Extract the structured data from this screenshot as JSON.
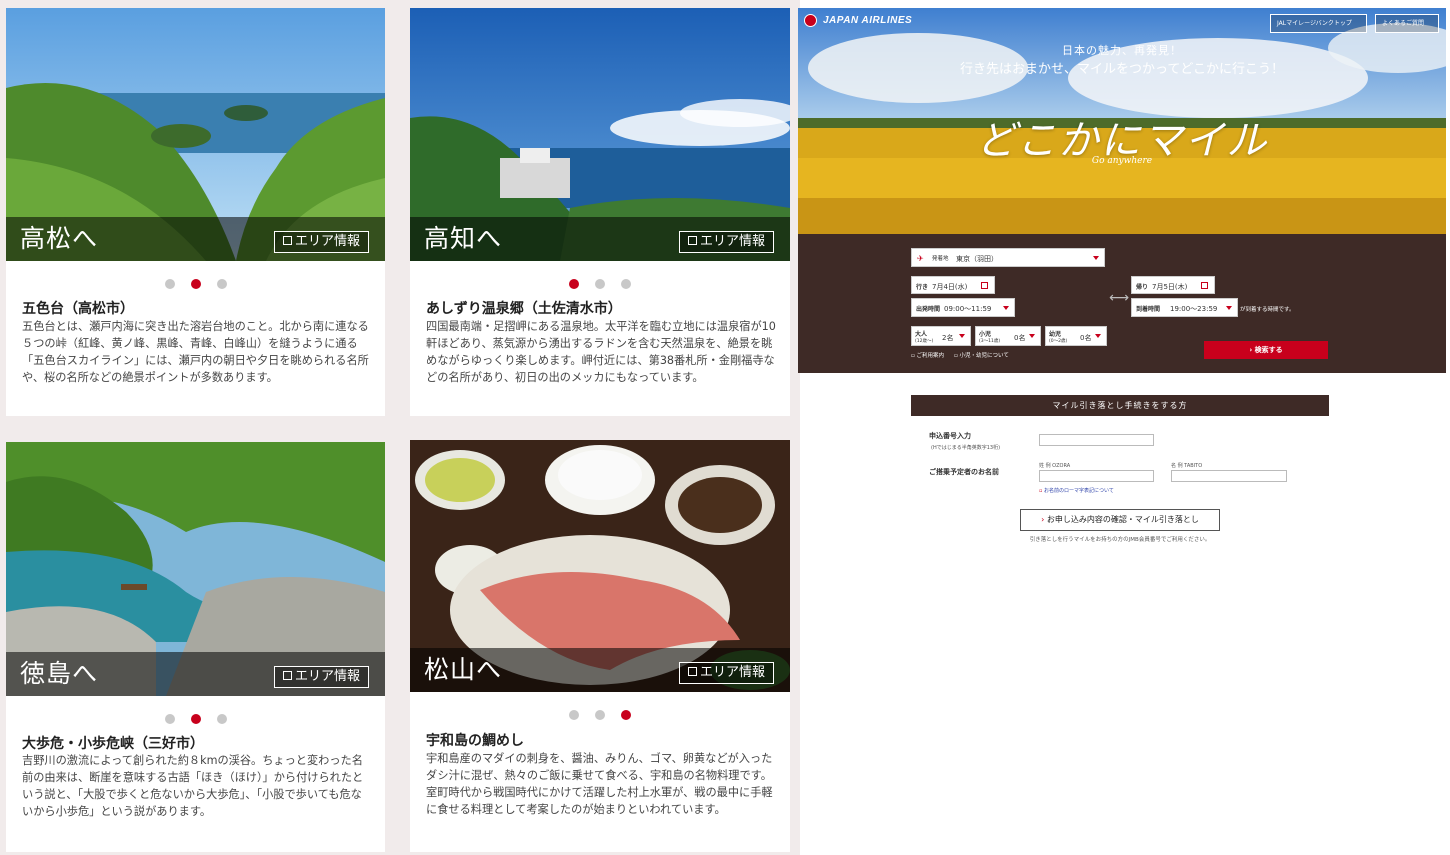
{
  "cards": [
    {
      "city": "高松へ",
      "area_button": "エリア情報",
      "title": "五色台（高松市）",
      "desc": "五色台とは、瀬戸内海に突き出た溶岩台地のこと。北から南に連なる５つの峠（紅峰、黄ノ峰、黒峰、青峰、白峰山）を縫うように通る「五色台スカイライン」には、瀬戸内の朝日や夕日を眺められる名所や、桜の名所などの絶景ポイントが多数あります。",
      "active_dot": 2
    },
    {
      "city": "高知へ",
      "area_button": "エリア情報",
      "title": "あしずり温泉郷（土佐清水市）",
      "desc": "四国最南端・足摺岬にある温泉地。太平洋を臨む立地には温泉宿が10軒ほどあり、蒸気源から湧出するラドンを含む天然温泉を、絶景を眺めながらゆっくり楽しめます。岬付近には、第38番札所・金剛福寺などの名所があり、初日の出のメッカにもなっています。",
      "active_dot": 1
    },
    {
      "city": "徳島へ",
      "area_button": "エリア情報",
      "title": "大歩危・小歩危峡（三好市）",
      "desc": "吉野川の激流によって創られた約８kmの渓谷。ちょっと変わった名前の由来は、断崖を意味する古語「ほき（ほけ）」から付けられたという説と、「大股で歩くと危ないから大歩危」、「小股で歩いても危ないから小歩危」という説があります。",
      "active_dot": 2
    },
    {
      "city": "松山へ",
      "area_button": "エリア情報",
      "title": "宇和島の鯛めし",
      "desc": "宇和島産のマダイの刺身を、醤油、みりん、ゴマ、卵黄などが入ったダシ汁に混ぜ、熱々のご飯に乗せて食べる、宇和島の名物料理です。室町時代から戦国時代にかけて活躍した村上水軍が、戦の最中に手軽に食せる料理として考案したのが始まりといわれています。",
      "active_dot": 3
    }
  ],
  "jal": {
    "logo": "JAPAN AIRLINES",
    "top_buttons": [
      "JALマイレージバンクトップ",
      "よくあるご質問"
    ],
    "tagline1": "日本の魅力、再発見！",
    "tagline2": "行き先はおまかせ、マイルをつかってどこかに行こう！",
    "title": "どこかにマイル",
    "title_sub": "Go anywhere",
    "form": {
      "departure_label": "発着地",
      "departure_value": "東京（羽田）",
      "outbound_label": "行き",
      "outbound_date": "7月4日(水)",
      "return_label": "帰り",
      "return_date": "7月5日(木)",
      "dep_time_label": "出発時間",
      "dep_time_value": "09:00～11:59",
      "ret_time_label": "到着時間",
      "ret_time_value": "19:00～23:59",
      "time_note": "が到着する時間です。",
      "adult_label": "大人",
      "adult_sub": "(12歳～)",
      "adult_value": "2名",
      "child_label": "小児",
      "child_sub": "(3～11歳)",
      "child_value": "0名",
      "infant_label": "幼児",
      "infant_sub": "(0～2歳)",
      "infant_value": "0名",
      "link1": "ご利用案内",
      "link2": "小児・幼児について",
      "search": "検索する"
    }
  },
  "mile": {
    "heading": "マイル引き落とし手続きをする方",
    "app_no_label": "申込番号入力",
    "app_no_sub": "(Hではじまる半角英数字13桁)",
    "name_label": "ご搭乗予定者のお名前",
    "surname_label": "姓 例 OZORA",
    "given_label": "名 例 TABITO",
    "romaji_link": "お名前のローマ字表記について",
    "cta": "お申し込み内容の確認・マイル引き落とし",
    "note": "引き落としを行うマイルをお持ちの方のJMB会員番号でご利用ください。"
  },
  "colors": {
    "accent": "#c8001c",
    "jal_brown": "#3e2a26",
    "bg": "#f1ebeb"
  }
}
